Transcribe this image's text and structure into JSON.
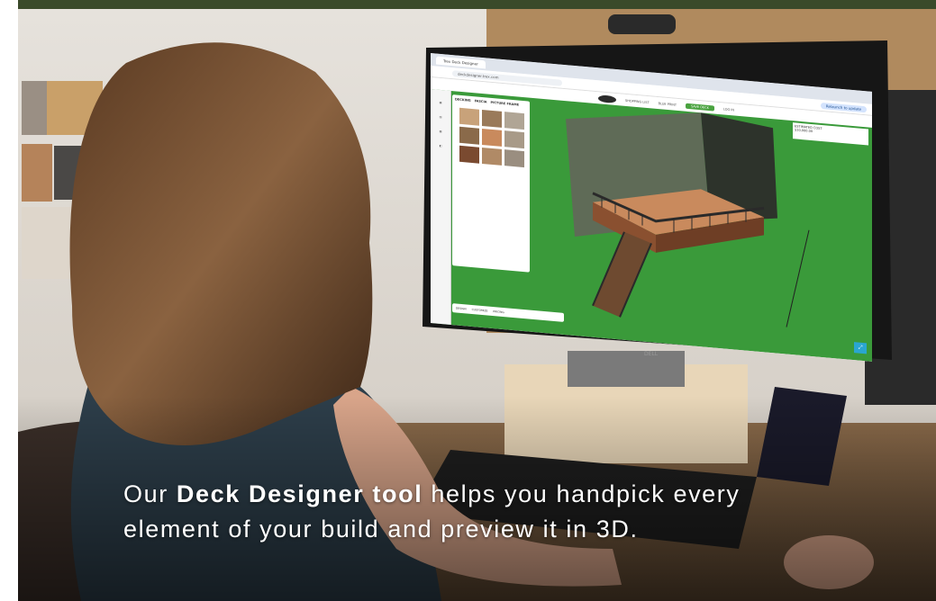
{
  "caption": {
    "prefix": "Our ",
    "highlight": "Deck Designer tool",
    "suffix": " helps you handpick every element of your build and preview it in 3D."
  },
  "screen": {
    "browser_tab": "Trex Deck Designer",
    "url": "deckdesigner.trex.com",
    "relaunch_button": "Relaunch to update",
    "app_nav": [
      "SHOPPING LIST",
      "BLUE PRINT"
    ],
    "save_button": "SAVE DECK",
    "login": "LOG IN",
    "panel_tabs": [
      "DECKING",
      "FASCIA",
      "PICTURE FRAME"
    ],
    "estimate_label": "ESTIMATED COST",
    "estimate_value": "$10,000.00",
    "steps": [
      "DESIGN",
      "CUSTOMIZE",
      "PRICING"
    ]
  },
  "colors": {
    "lawn": "#3a9a3a",
    "deck_board": "#c98a5d",
    "railing": "#2a2a2a",
    "wall": "#5f6b57",
    "hair": "#6e4a2c",
    "topbar": "#3a4a2a"
  }
}
